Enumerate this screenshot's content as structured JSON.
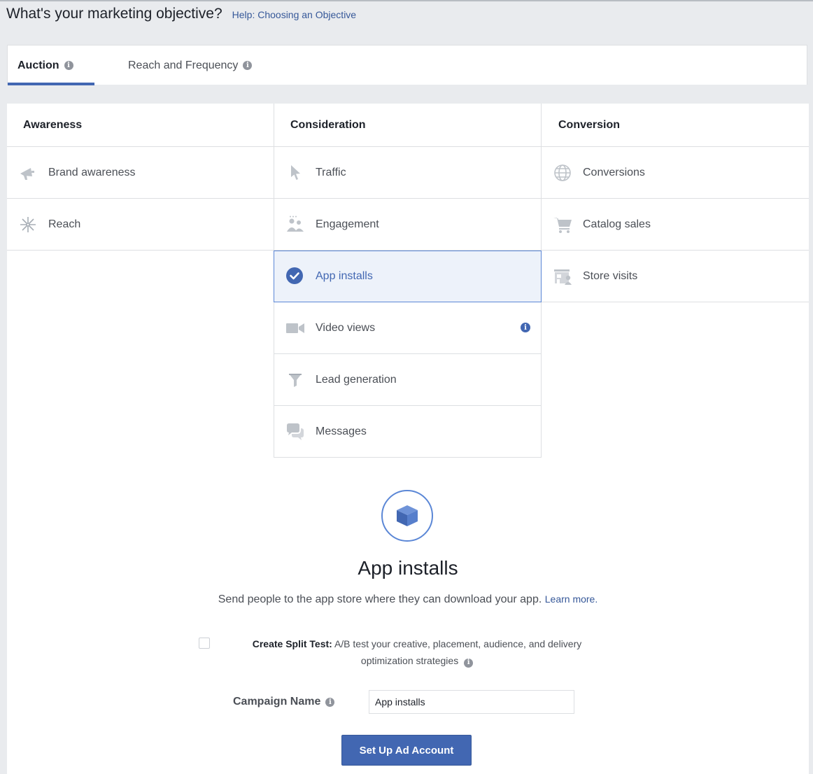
{
  "header": {
    "title": "What's your marketing objective?",
    "help_link": "Help: Choosing an Objective"
  },
  "tabs": [
    {
      "label": "Auction",
      "active": true
    },
    {
      "label": "Reach and Frequency",
      "active": false
    }
  ],
  "columns": {
    "awareness": {
      "header": "Awareness",
      "items": [
        {
          "label": "Brand awareness",
          "icon": "megaphone-icon"
        },
        {
          "label": "Reach",
          "icon": "reach-icon"
        }
      ]
    },
    "consideration": {
      "header": "Consideration",
      "items": [
        {
          "label": "Traffic",
          "icon": "cursor-icon"
        },
        {
          "label": "Engagement",
          "icon": "people-icon"
        },
        {
          "label": "App installs",
          "icon": "check-circle-icon",
          "selected": true
        },
        {
          "label": "Video views",
          "icon": "video-camera-icon"
        },
        {
          "label": "Lead generation",
          "icon": "funnel-icon"
        },
        {
          "label": "Messages",
          "icon": "chat-bubbles-icon"
        }
      ]
    },
    "conversion": {
      "header": "Conversion",
      "items": [
        {
          "label": "Conversions",
          "icon": "globe-icon"
        },
        {
          "label": "Catalog sales",
          "icon": "cart-icon"
        },
        {
          "label": "Store visits",
          "icon": "store-icon"
        }
      ]
    }
  },
  "detail": {
    "icon": "cube-icon",
    "title": "App installs",
    "description": "Send people to the app store where they can download your app.",
    "learn_more": "Learn more."
  },
  "split_test": {
    "label": "Create Split Test:",
    "text": "A/B test your creative, placement, audience, and delivery optimization strategies"
  },
  "campaign": {
    "label": "Campaign Name",
    "value": "App installs"
  },
  "setup_button": "Set Up Ad Account",
  "colors": {
    "accent": "#4267b2",
    "link": "#365899",
    "background": "#e9ebee",
    "selected_bg": "#edf2fa"
  }
}
